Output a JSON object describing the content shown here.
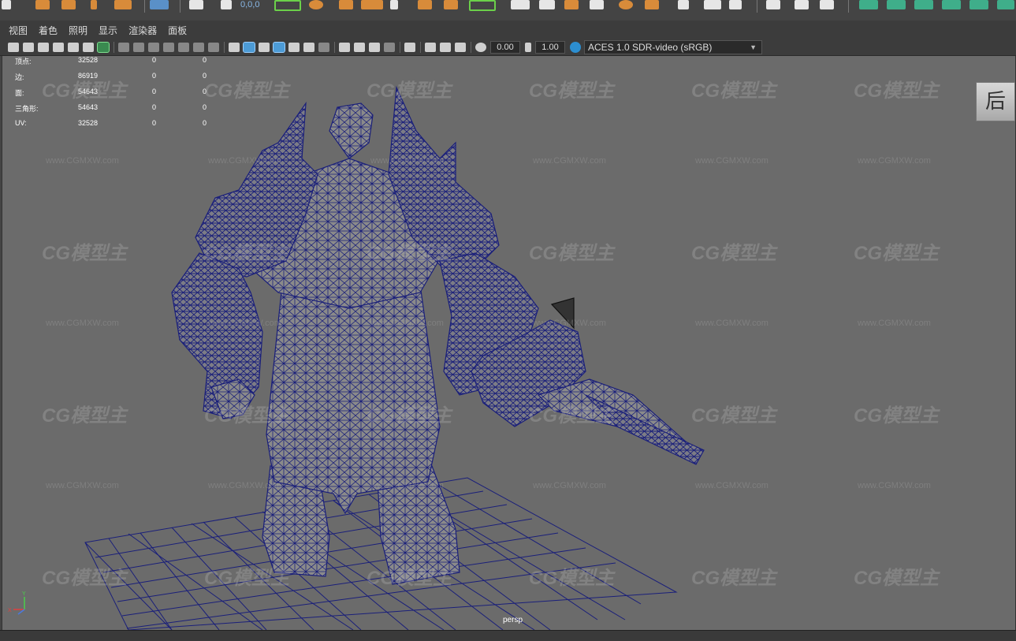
{
  "menubar": {
    "items": [
      "视图",
      "着色",
      "照明",
      "显示",
      "渲染器",
      "面板"
    ]
  },
  "shelf": {
    "coordinate_text": "0,0,0"
  },
  "viewport_toolbar": {
    "exposure_value": "0.00",
    "gamma_value": "1.00",
    "color_space": "ACES 1.0 SDR-video (sRGB)"
  },
  "hud_stats": {
    "rows": [
      {
        "label": "顶点:",
        "values": [
          "32528",
          "0",
          "0"
        ]
      },
      {
        "label": "边:",
        "values": [
          "86919",
          "0",
          "0"
        ]
      },
      {
        "label": "面:",
        "values": [
          "54643",
          "0",
          "0"
        ]
      },
      {
        "label": "三角形:",
        "values": [
          "54643",
          "0",
          "0"
        ]
      },
      {
        "label": "UV:",
        "values": [
          "32528",
          "0",
          "0"
        ]
      }
    ]
  },
  "viewcube": {
    "label": "后"
  },
  "camera": {
    "name": "persp"
  },
  "axis": {
    "y": "Y",
    "x": "X"
  },
  "watermark": {
    "logo": "CG模型主",
    "url": "www.CGMXW.com"
  },
  "colors": {
    "wireframe": "#1a1f7a",
    "viewport_bg": "#6b6b6b",
    "panel_bg": "#3c3c3c"
  }
}
